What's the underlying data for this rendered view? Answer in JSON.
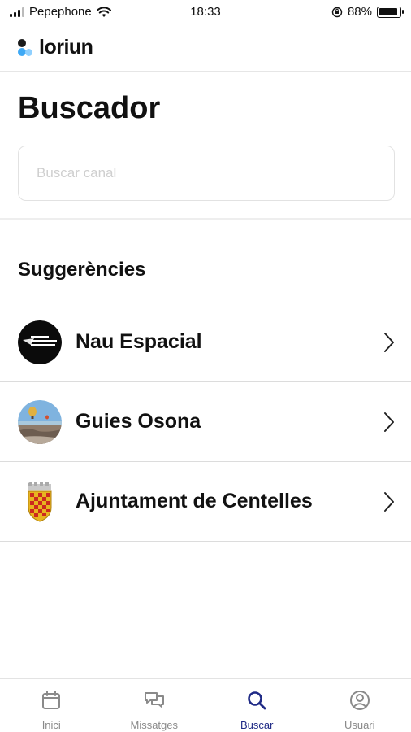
{
  "status_bar": {
    "carrier": "Pepephone",
    "time": "18:33",
    "battery_percent": "88%",
    "battery_level": 0.88
  },
  "header": {
    "logo_text": "loriun",
    "logo_colors": [
      "#1a1a1a",
      "#3fa9f5",
      "#8fd0ff"
    ]
  },
  "page": {
    "title": "Buscador",
    "search_placeholder": "Buscar canal"
  },
  "suggestions": {
    "title": "Suggerències",
    "items": [
      {
        "label": "Nau Espacial",
        "avatar": "nau-espacial-logo"
      },
      {
        "label": "Guies Osona",
        "avatar": "guies-osona-photo"
      },
      {
        "label": "Ajuntament de Centelles",
        "avatar": "centelles-coat-of-arms"
      }
    ]
  },
  "tabs": [
    {
      "label": "Inici",
      "icon": "calendar-icon",
      "active": false
    },
    {
      "label": "Missatges",
      "icon": "chat-icon",
      "active": false
    },
    {
      "label": "Buscar",
      "icon": "search-icon",
      "active": true
    },
    {
      "label": "Usuari",
      "icon": "user-icon",
      "active": false
    }
  ],
  "colors": {
    "accent": "#1f2a86",
    "inactive": "#8a8a8a"
  }
}
